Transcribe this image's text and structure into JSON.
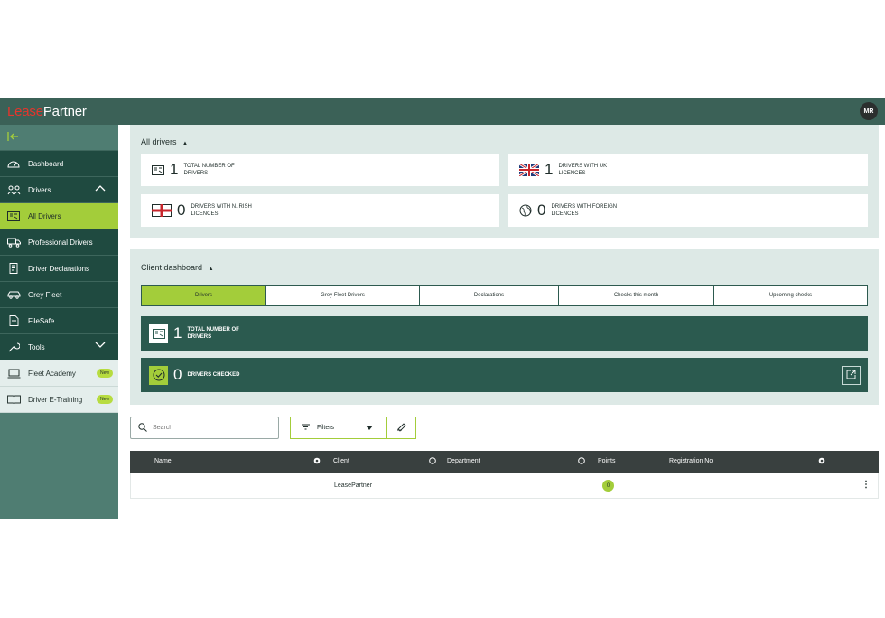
{
  "header": {
    "logo_lease": "Lease",
    "logo_partner": "Partner",
    "avatar_initials": "MR"
  },
  "sidebar": {
    "collapse_icon": "collapse-left-icon",
    "items": [
      {
        "label": "Dashboard",
        "icon": "dashboard-gauge-icon"
      },
      {
        "label": "Drivers",
        "icon": "drivers-group-icon"
      },
      {
        "label": "All Drivers",
        "icon": "id-card-icon"
      },
      {
        "label": "Professional Drivers",
        "icon": "truck-icon"
      },
      {
        "label": "Driver Declarations",
        "icon": "declarations-icon"
      },
      {
        "label": "Grey Fleet",
        "icon": "car-icon"
      },
      {
        "label": "FileSafe",
        "icon": "file-icon"
      },
      {
        "label": "Tools",
        "icon": "tools-icon"
      },
      {
        "label": "Fleet Academy",
        "icon": "laptop-icon",
        "badge": "New"
      },
      {
        "label": "Driver E-Training",
        "icon": "book-icon",
        "badge": "New"
      }
    ]
  },
  "all_drivers": {
    "title": "All drivers",
    "cards": [
      {
        "value": "1",
        "label": "TOTAL NUMBER OF DRIVERS"
      },
      {
        "value": "1",
        "label": "DRIVERS WITH UK LICENCES"
      },
      {
        "value": "0",
        "label": "DRIVERS WITH N.IRISH LICENCES"
      },
      {
        "value": "0",
        "label": "DRIVERS WITH FOREIGN LICENCES"
      }
    ]
  },
  "client_dashboard": {
    "title": "Client dashboard",
    "tabs": [
      "Drivers",
      "Grey Fleet Drivers",
      "Declarations",
      "Checks this month",
      "Upcoming checks"
    ],
    "active_tab": "Drivers",
    "cards": [
      {
        "value": "1",
        "label": "TOTAL NUMBER OF DRIVERS"
      },
      {
        "value": "0",
        "label": "DRIVERS CHECKED"
      }
    ]
  },
  "toolbar": {
    "search_placeholder": "Search",
    "filters_label": "Filters"
  },
  "table": {
    "columns": [
      "Name",
      "Client",
      "Department",
      "Points",
      "Registration No"
    ],
    "rows": [
      {
        "name": "",
        "client": "LeasePartner",
        "department": "",
        "points": "0",
        "registration": ""
      }
    ]
  },
  "colors": {
    "accent": "#a3cd3a",
    "primary_dark": "#2b5a4f",
    "topbar": "#3b6157",
    "logo_red": "#e5352c"
  }
}
